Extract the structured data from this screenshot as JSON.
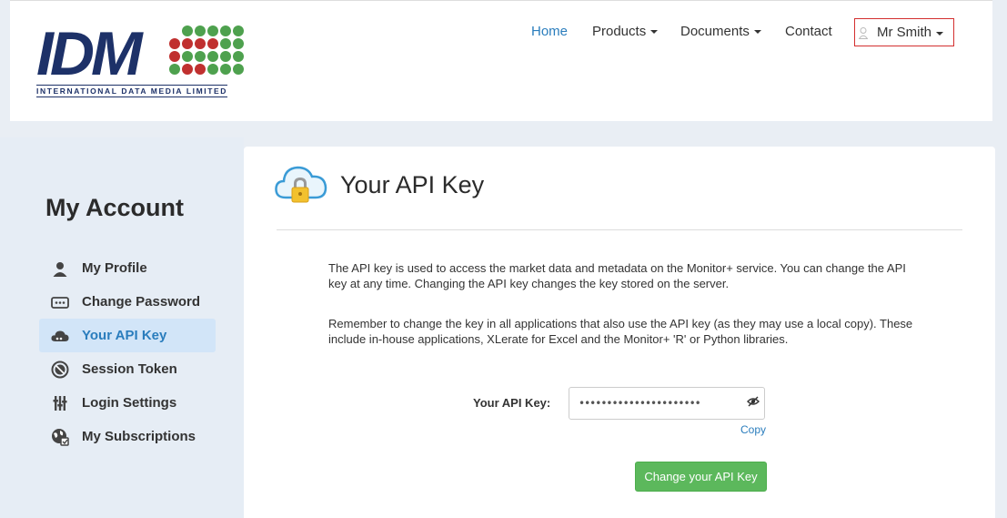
{
  "logo": {
    "text": "IDM",
    "subtitle": "INTERNATIONAL DATA MEDIA LIMITED",
    "dot_colors": [
      "#1d3168",
      "#4ea14e",
      "#4ea14e",
      "#4ea14e",
      "#4ea14e",
      "#4ea14e",
      "#c0302f",
      "#c0302f",
      "#c0302f",
      "#c0302f",
      "#4ea14e",
      "#4ea14e",
      "#c0302f",
      "#4ea14e",
      "#4ea14e",
      "#4ea14e",
      "#4ea14e",
      "#4ea14e",
      "#4ea14e",
      "#c0302f",
      "#c0302f",
      "#4ea14e",
      "#4ea14e",
      "#4ea14e"
    ]
  },
  "nav": {
    "home": "Home",
    "products": "Products",
    "documents": "Documents",
    "contact": "Contact",
    "user": "Mr Smith"
  },
  "sidebar": {
    "title": "My Account",
    "items": [
      {
        "label": "My Profile",
        "icon": "user-icon"
      },
      {
        "label": "Change Password",
        "icon": "password-icon"
      },
      {
        "label": "Your API Key",
        "icon": "cloud-icon",
        "active": true
      },
      {
        "label": "Session Token",
        "icon": "token-icon"
      },
      {
        "label": "Login Settings",
        "icon": "sliders-icon"
      },
      {
        "label": "My Subscriptions",
        "icon": "globe-icon"
      }
    ]
  },
  "main": {
    "title": "Your API Key",
    "paragraph1": "The API key is used to access the market data and metadata on the Monitor+ service. You can change the API key at any time. Changing the API key changes the key stored on the server.",
    "paragraph2": "Remember to change the key in all applications that also use the API key (as they may use a local copy). These include in-house applications, XLerate for Excel and the Monitor+ 'R' or Python libraries.",
    "key_label": "Your API Key:",
    "key_value": "••••••••••••••••••••••",
    "copy_label": "Copy",
    "change_button": "Change your API Key"
  },
  "colors": {
    "accent": "#2a7dbd",
    "button_green": "#5cb85c",
    "active_bg": "#d2e5f8",
    "user_border": "#d32f2f"
  }
}
